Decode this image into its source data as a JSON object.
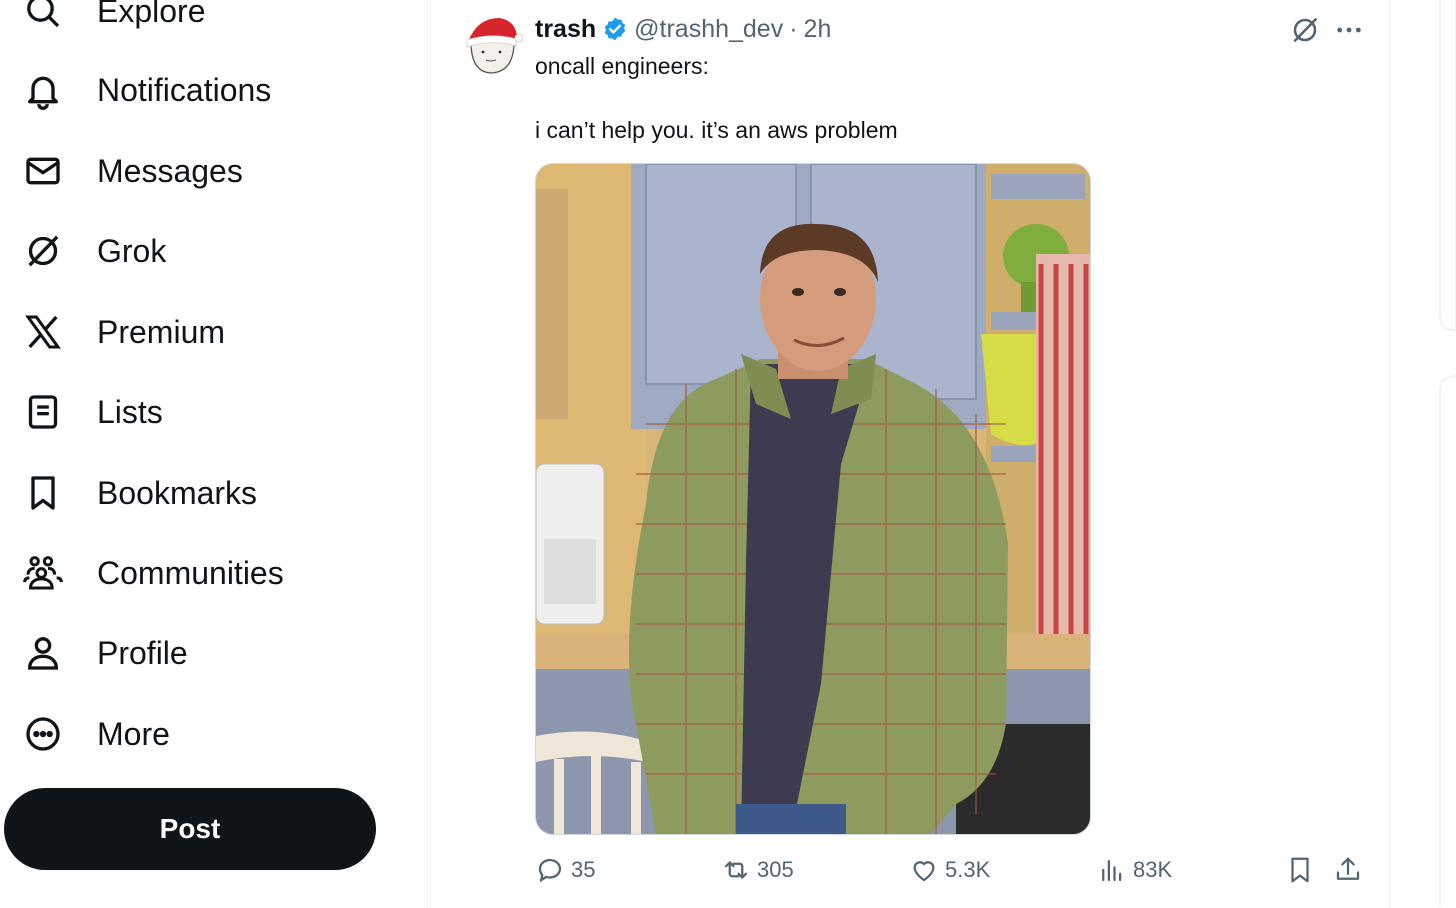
{
  "sidebar": {
    "items": [
      {
        "label": "Explore",
        "icon": "search-icon"
      },
      {
        "label": "Notifications",
        "icon": "bell-icon"
      },
      {
        "label": "Messages",
        "icon": "envelope-icon"
      },
      {
        "label": "Grok",
        "icon": "grok-icon"
      },
      {
        "label": "Premium",
        "icon": "x-logo-icon"
      },
      {
        "label": "Lists",
        "icon": "list-icon"
      },
      {
        "label": "Bookmarks",
        "icon": "bookmark-icon"
      },
      {
        "label": "Communities",
        "icon": "communities-icon"
      },
      {
        "label": "Profile",
        "icon": "person-icon"
      },
      {
        "label": "More",
        "icon": "more-circle-icon"
      }
    ],
    "post_label": "Post"
  },
  "tweet": {
    "author_name": "trash",
    "handle": "@trashh_dev",
    "separator": "·",
    "time": "2h",
    "text": "oncall engineers:\n\ni can’t help you. it’s an aws problem",
    "verified_color": "#1d9bf0",
    "actions": {
      "replies": "35",
      "reposts": "305",
      "likes": "5.3K",
      "views": "83K"
    }
  },
  "colors": {
    "text_primary": "#0f1419",
    "text_secondary": "#536471",
    "post_button_bg": "#0f1419",
    "border": "#eff3f4"
  }
}
